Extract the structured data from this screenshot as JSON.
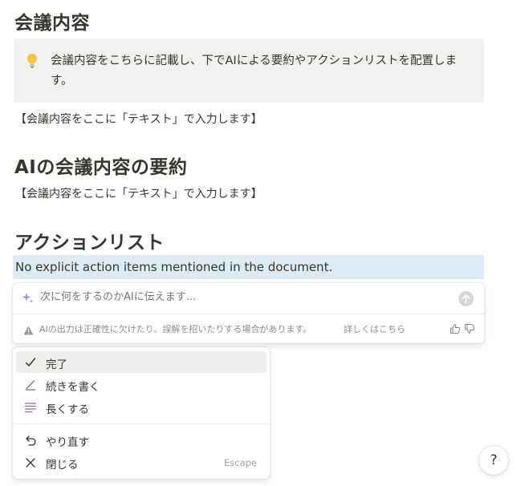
{
  "headings": {
    "meeting": "会議内容",
    "summary": "AIの会議内容の要約",
    "actions": "アクションリスト"
  },
  "callout": {
    "icon": "lightbulb-icon",
    "text": "会議内容をこちらに記載し、下でAIによる要約やアクションリストを配置します。"
  },
  "placeholders": {
    "meeting_text": "【会議内容をここに「テキスト」で入力します】",
    "summary_text": "【会議内容をここに「テキスト」で入力します】"
  },
  "ai_output": "No explicit action items mentioned in the document.",
  "ai_prompt": {
    "placeholder": "次に何をするのかAIに伝えます...",
    "warning": "AIの出力は正確性に欠けたり、誤解を招いたりする場合があります。",
    "learn_more": "詳しくはこちら"
  },
  "menu": {
    "items": [
      {
        "label": "完了",
        "icon": "check-icon"
      },
      {
        "label": "続きを書く",
        "icon": "pencil-icon"
      },
      {
        "label": "長くする",
        "icon": "lines-icon"
      }
    ],
    "secondary": [
      {
        "label": "やり直す",
        "icon": "undo-icon"
      },
      {
        "label": "閉じる",
        "icon": "close-icon",
        "shortcut": "Escape"
      }
    ]
  },
  "help": {
    "label": "?"
  },
  "colors": {
    "highlight": "#dcebf8",
    "callout_bg": "#f1f1ef",
    "accent_purple": "#9065b0",
    "text": "#37352f"
  }
}
